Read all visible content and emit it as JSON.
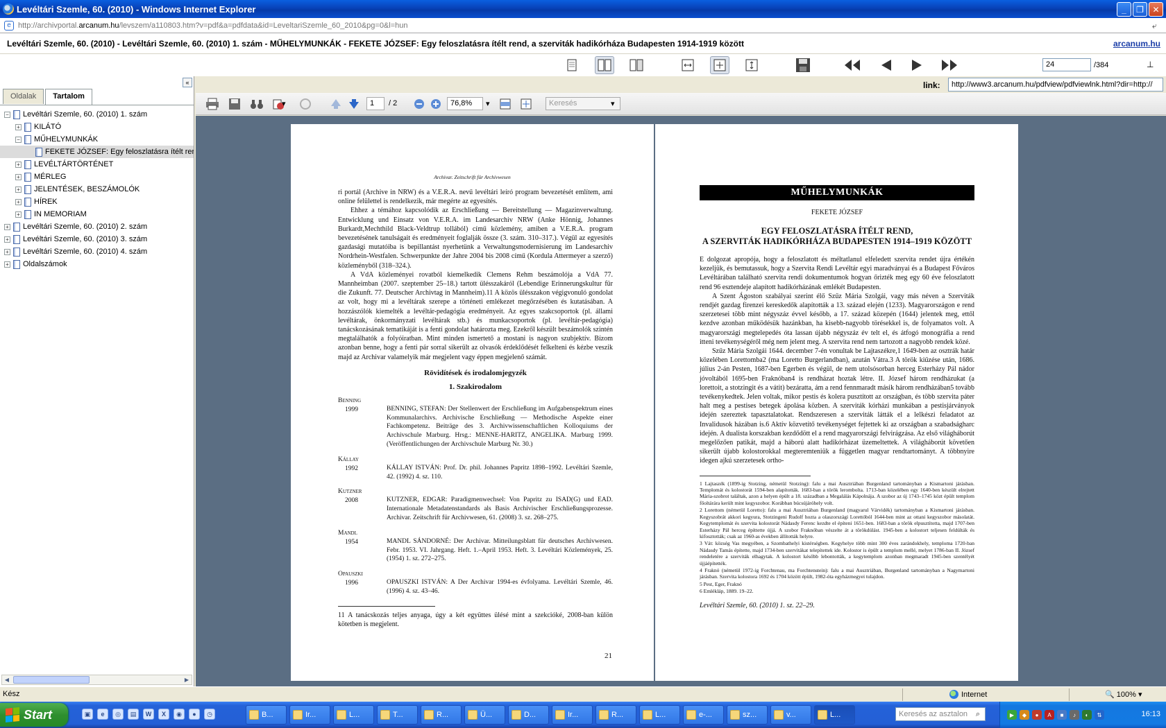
{
  "window": {
    "title": "Levéltári Szemle, 60. (2010) - Windows Internet Explorer",
    "buttons": [
      "_",
      "❐",
      "✕"
    ]
  },
  "address": {
    "url_prefix": "http://archivportal.",
    "url_domain": "arcanum.hu",
    "url_rest": "/levszem/a110803.htm?v=pdf&a=pdfdata&id=LeveltariSzemle_60_2010&pg=0&l=hun"
  },
  "header": {
    "doc_title": "Levéltári Szemle, 60. (2010) - Levéltári Szemle, 60. (2010) 1. szám - MŰHELYMUNKÁK - FEKETE JÓZSEF: Egy feloszlatásra ítélt rend, a szerviták hadikórháza Budapesten 1914-1919 között",
    "brand": "arcanum.hu"
  },
  "viewer_toolbar": {
    "page_value": "24",
    "page_total": "/384",
    "pin": "⊥"
  },
  "link": {
    "label": "link:",
    "value": "http://www3.arcanum.hu/pdfview/pdfviewlnk.html?dir=http://"
  },
  "sidebar": {
    "collapse": "«",
    "tabs": [
      "Oldalak",
      "Tartalom"
    ],
    "tree": [
      {
        "label": "Levéltári Szemle, 60. (2010) 1. szám",
        "level": 0,
        "exp": "−"
      },
      {
        "label": "KILÁTÓ",
        "level": 1,
        "exp": "+"
      },
      {
        "label": "MŰHELYMUNKÁK",
        "level": 1,
        "exp": "−"
      },
      {
        "label": "FEKETE JÓZSEF: Egy feloszlatásra ítélt rend",
        "level": 2,
        "exp": ""
      },
      {
        "label": "LEVÉLTÁRTÖRTÉNET",
        "level": 1,
        "exp": "+"
      },
      {
        "label": "MÉRLEG",
        "level": 1,
        "exp": "+"
      },
      {
        "label": "JELENTÉSEK, BESZÁMOLÓK",
        "level": 1,
        "exp": "+"
      },
      {
        "label": "HÍREK",
        "level": 1,
        "exp": "+"
      },
      {
        "label": "IN MEMORIAM",
        "level": 1,
        "exp": "+"
      },
      {
        "label": "Levéltári Szemle, 60. (2010) 2. szám",
        "level": 0,
        "exp": "+"
      },
      {
        "label": "Levéltári Szemle, 60. (2010) 3. szám",
        "level": 0,
        "exp": "+"
      },
      {
        "label": "Levéltári Szemle, 60. (2010) 4. szám",
        "level": 0,
        "exp": "+"
      },
      {
        "label": "Oldalszámok",
        "level": 0,
        "exp": "+"
      }
    ]
  },
  "pdf_toolbar": {
    "page_value": "1",
    "page_total": "/ 2",
    "zoom_value": "76,8%",
    "search_placeholder": "Keresés"
  },
  "left_page": {
    "running_head": "Archivar. Zeitschrift für Archivwesen",
    "para1": "ri portál (Archive in NRW) és a V.E.R.A. nevű levéltári leíró program bevezetését említem, ami online felülettel is rendelkezik, már megérte az egyesítés.",
    "para2": "Ehhez a témához kapcsolódik az Erschließung — Bereitstellung — Magazinverwaltung. Entwicklung und Einsatz von V.E.R.A. im Landesarchiv NRW (Anke Hönnig, Johannes Burkardt,Mechthild Black-Veldtrup tollából) című közlemény, amiben a V.E.R.A. program bevezetésének tanulságait és eredményeit foglalják össze (3. szám. 310–317.). Végül az egyesítés gazdasági mutatóiba is bepillantást nyerhetünk a Verwaltungsmodernisierung im Landesarchiv Nordrhein-Westfalen. Schwerpunkte der Jahre 2004 bis 2008 című (Kordula Attermeyer a szerző) közleményből (318–324.).",
    "para3": "A VdA közleményei rovatból kiemelkedik Clemens Rehm beszámolója a VdA 77. Mannheimban (2007. szeptember 25–18.) tartott ülésszakáról (Lebendige Erinnerungskultur für die Zukunft. 77. Deutscher Archivtag in Mannheim).11 A közös ülésszakon végigvonuló gondolat az volt, hogy mi a levéltárak szerepe a történeti emlékezet megőrzésében és kutatásában. A hozzászólók kiemelték a levéltár-pedagógia eredményeit. Az egyes szakcsoportok (pl. állami levéltárak, önkormányzati levéltárak stb.) és munkacsoportok (pl. levéltár-pedagógia) tanácskozásának tematikáját is a fenti gondolat határozta meg. Ezekről készült beszámolók szintén megtalálhatók a folyóiratban. Mint minden ismertető a mostani is nagyon szubjektív. Bízom azonban benne, hogy a fenti pár sorral sikerült az olvasók érdeklődését felkelteni és kézbe veszik majd az Archivar valamelyik már megjelent vagy éppen megjelenő számát.",
    "section": "Rövidítések és irodalomjegyzék",
    "subsection": "1. Szakirodalom",
    "refs": [
      {
        "key": "Benning",
        "year": "1999",
        "text": "BENNING, STEFAN: Der Stellenwert der Erschließung im Aufgabenspektrum eines Kommunalarchivs. Archivische Erschließung — Methodische Aspekte einer Fachkompetenz. Beiträge des 3. Archivwissenschaftlichen Kolloquiums der Archivschule Marburg. Hrsg.: MENNE-HARITZ, ANGELIKA. Marburg 1999. (Veröffentlichungen der Archivschule Marburg Nr. 30.)"
      },
      {
        "key": "Kállay",
        "year": "1992",
        "text": "KÁLLAY ISTVÁN: Prof. Dr. phil. Johannes Papritz 1898–1992. Levéltári Szemle, 42. (1992) 4. sz. 110."
      },
      {
        "key": "Kutzner",
        "year": "2008",
        "text": "KUTZNER, EDGAR: Paradigmenwechsel: Von Papritz zu ISAD(G) und EAD. Internationale Metadatenstandards als Basis Archivischer Erschließungsprozesse. Archivar. Zeitschrift für Archivwesen, 61. (2008) 3. sz. 268–275."
      },
      {
        "key": "Mandl",
        "year": "1954",
        "text": "MANDL SÁNDORNÉ: Der Archivar. Mitteilungsblatt für deutsches Archivwesen. Febr. 1953. VI. Jahrgang. Heft. 1.–April 1953. Heft. 3. Levéltári Közlemények, 25. (1954) 1. sz. 272–275."
      },
      {
        "key": "Opauszki",
        "year": "1996",
        "text": "OPAUSZKI ISTVÁN: A Der Archivar 1994-es évfolyama. Levéltári Szemle, 46. (1996) 4. sz. 43–46."
      }
    ],
    "footnote": "11 A tanácskozás teljes anyaga, úgy a két együttes ülésé mint a szekcióké, 2008-ban külön kötetben is megjelent.",
    "page_number": "21"
  },
  "right_page": {
    "section": "MŰHELYMUNKÁK",
    "author": "FEKETE JÓZSEF",
    "title_line1": "EGY FELOSZLATÁSRA ÍTÉLT REND,",
    "title_line2": "A SZERVITÁK HADIKÓRHÁZA BUDAPESTEN 1914–1919 KÖZÖTT",
    "para1": "E dolgozat apropója, hogy a feloszlatott és méltatlanul elfeledett szervita rendet újra értékén kezeljük, és bemutassuk, hogy a Szervita Rendi Levéltár egyi maradványai és a Budapest Főváros Levéltárában található szervita rendi dokumentumok hogyan őrizték meg egy 60 éve feloszlatott rend 96 esztendeje alapított hadikórházának emlékét Budapesten.",
    "para2": "A Szent Ágoston szabályai szerint élő Szűz Mária Szolgái, vagy más néven a Szerviták rendjét gazdag firenzei kereskedők alapították a 13. század elején (1233). Magyarországon e rend szerzetesei több mint négyszáz évvel később, a 17. század közepén (1644) jelentek meg, ettől kezdve azonban működésük hazánkban, ha kisebb-nagyobb törésekkel is, de folyamatos volt. A magyarországi megtelepedés óta lassan újabb négyszáz év telt el, és átfogó monográfia a rend itteni tevékenységéről még nem jelent meg. A szervita rend nem tartozott a nagyobb rendek közé.",
    "para3": "Szűz Mária Szolgái 1644. december 7-én vonultak be Lajtaszékre,1 1649-ben az osztrák határ közelében Lorettomba2 (ma Loretto Burgerlandban), azután Vátra.3 A török kiűzése után, 1686. július 2-án Pesten, 1687-ben Egerben és végül, de nem utolsósorban herceg Esterházy Pál nádor jóvoltából 1695-ben Fraknóban4 is rendházat hoztak létre. II. József három rendházukat (a lorettoit, a stotzingit és a vátit) bezáratta, ám a rend fennmaradt másik három rendházában5 tovább tevékenykedtek. Jelen voltak, mikor pestis és kolera pusztított az országban, és több szervita páter halt meg a pestises betegek ápolása közben. A szerviták kórházi munkában a pestisjárványok idején szereztek tapasztalatokat. Rendszeresen a szerviták látták el a lelkészi feladatot az Invalidusok házában is.6 Aktív közvetítő tevékenységet fejtettek ki az országban a szabadságharc idején. A dualista korszakban kezdődött el a rend magyarországi felvirágzása. Az első világháborút megelőzően patikát, majd a háború alatt hadikórházat üzemeltettek. A világháborút követően sikerült újabb kolostorokkal megteremteniük a független magyar rendtartományt. A többnyire idegen ajkú szerzetesek ortho-",
    "footnotes": [
      "1 Lajtaszék (1899-ig Stotzing, németül Stotzing): falu a mai Ausztriában Burgenland tartományban a Kismartoni járásban. Templomát és kolostorát 1594-ben alapították. 1683-ban a török lerombolta. 1713-ban közelében egy 1640-ben készült elrejtett Mária-szobrot találtak, azon a helyen épült a 18. században a Megalálás Kápolnája. A szobor az új 1743–1745 közt épült templom főoltárára került mint kegyszobor. Korábban búcsújáróhely volt.",
      "2 Lorettom (németül Loretto): falu a mai Ausztriában Burgenland (magyarul Várvidék) tartományban a Kismartoni járásban. Kegyszobrát akkori kegyura, Stotzingeni Rudolf hozta a olaszországi Lorettóból 1644-ben mint az ottani kegyszobor másolatát. Kegytemplomát és szervita kolostorát Nádasdy Ferenc kezdte el építeni 1651-ben. 1683-ban a török elpusztította, majd 1707-ben Esterházy Pál herceg építtette újjá. A szobor Fraknóban vészelte át a törökdúlást. 1945-ben a kolostort teljesen feldúlták és kifosztották; csak az 1960-as években állították helyre.",
      "3 Vát: község Vas megyében, a Szombathelyi kistérségben. Kegyhelye több mint 300 éves zarándokhely, temploma 1720-ban Nádasdy Tamás építette, majd 1734-ben szervitákat telepítettek ide. Kolostor is épült a templom mellé, melyet 1786-ban II. József rendeletére a szerviták elhagytak. A kolostort később lebontották, a kegytemplom azonban megmaradt 1945-ben szentélyét újjáépítették.",
      "4 Fraknó (németül 1972-ig Forchtenau, ma Forchtenstein): falu a mai Ausztriában, Burgenland tartományban a Nagymartoni járásban. Szervita kolostora 1692 és 1704 között épült, 1982-óta egyházmegyei tulajdon.",
      "5 Pest, Eger, Fraknó",
      "6 Emlékláp, 1889. 19–22."
    ],
    "source": "Levéltári Szemle, 60. (2010) 1. sz. 22–29."
  },
  "status": {
    "text": "Kész",
    "zone": "Internet",
    "zoom": "100%"
  },
  "taskbar": {
    "start": "Start",
    "tasks": [
      "B...",
      "Ir...",
      "L...",
      "T...",
      "R...",
      "Ü...",
      "D...",
      "Ir...",
      "R...",
      "L...",
      "e-...",
      "sz...",
      "v...",
      "L..."
    ],
    "search_placeholder": "Keresés az asztalon",
    "clock": "16:13"
  }
}
